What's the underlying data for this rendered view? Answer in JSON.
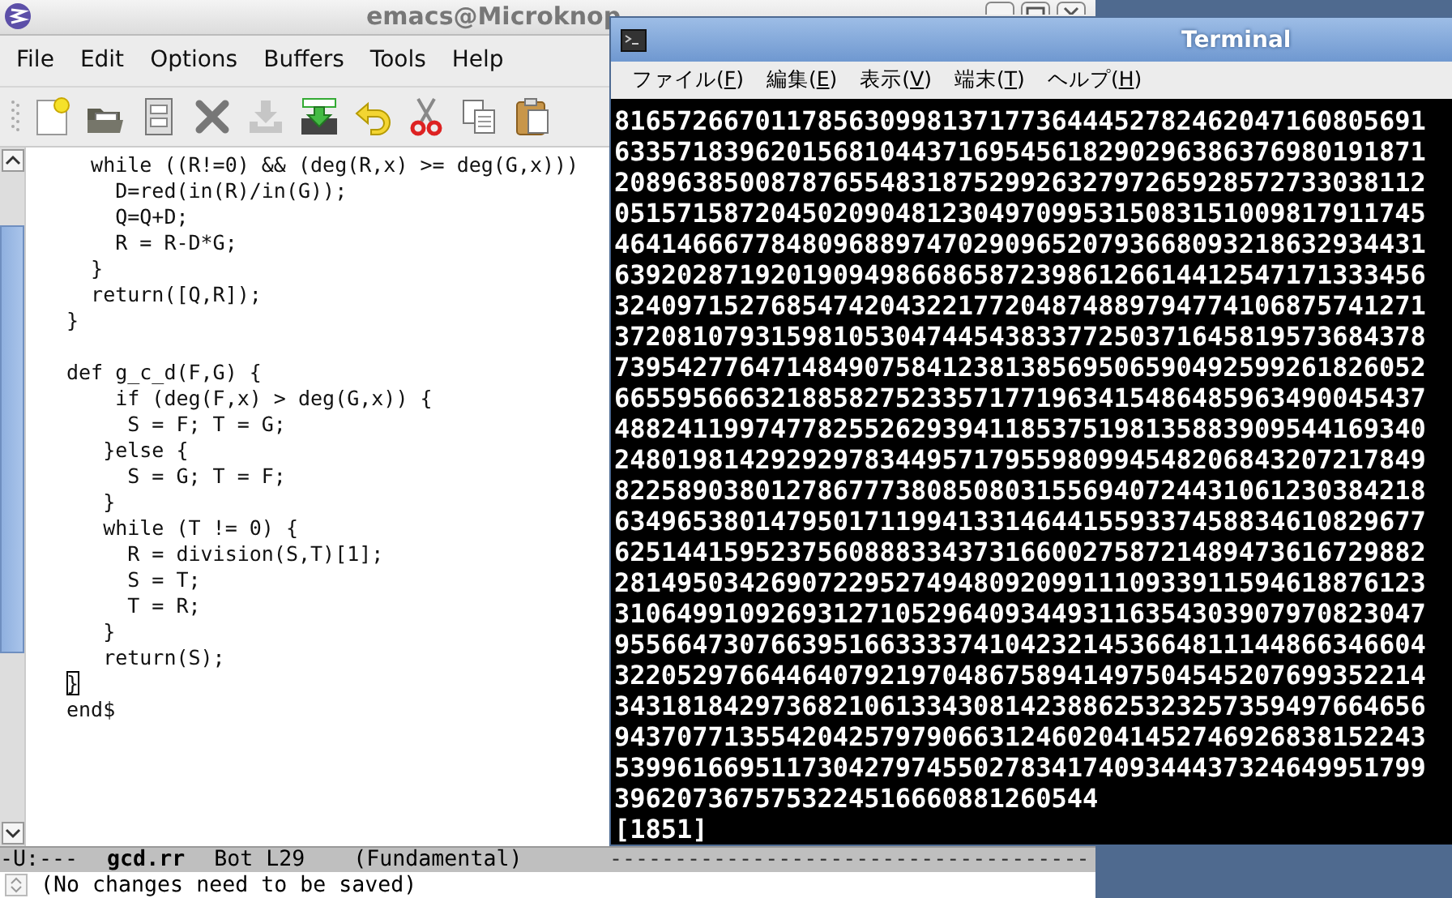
{
  "emacs_window": {
    "title": "emacs@Microknop",
    "menu": [
      "File",
      "Edit",
      "Options",
      "Buffers",
      "Tools",
      "Help"
    ],
    "toolbar": [
      {
        "kind": "new",
        "disabled": false
      },
      {
        "kind": "open",
        "disabled": false
      },
      {
        "kind": "save",
        "disabled": false
      },
      {
        "kind": "close",
        "disabled": false
      },
      {
        "kind": "download",
        "disabled": true
      },
      {
        "kind": "save-as",
        "disabled": false
      },
      {
        "kind": "undo",
        "disabled": false
      },
      {
        "kind": "cut",
        "disabled": false
      },
      {
        "kind": "copy",
        "disabled": false
      },
      {
        "kind": "paste",
        "disabled": false
      }
    ],
    "code_blocks": [
      [
        {
          "text": "  while ((R!=0) && (deg(R,x) >= deg(G,x)))",
          "cursor": false
        },
        {
          "text": "    D=red(in(R)/in(G));",
          "cursor": false
        },
        {
          "text": "    Q=Q+D;",
          "cursor": false
        },
        {
          "text": "    R = R-D*G;",
          "cursor": false
        },
        {
          "text": "  }",
          "cursor": false
        },
        {
          "text": "  return([Q,R]);",
          "cursor": false
        },
        {
          "text": "}",
          "cursor": false
        }
      ],
      [
        {
          "text": "def g_c_d(F,G) {",
          "cursor": false
        },
        {
          "text": "    if (deg(F,x) > deg(G,x)) {",
          "cursor": false
        },
        {
          "text": "     S = F; T = G;",
          "cursor": false
        },
        {
          "text": "   }else {",
          "cursor": false
        },
        {
          "text": "     S = G; T = F;",
          "cursor": false
        },
        {
          "text": "   }",
          "cursor": false
        },
        {
          "text": "   while (T != 0) {",
          "cursor": false
        },
        {
          "text": "     R = division(S,T)[1];",
          "cursor": false
        },
        {
          "text": "     S = T;",
          "cursor": false
        },
        {
          "text": "     T = R;",
          "cursor": false
        },
        {
          "text": "   }",
          "cursor": false
        },
        {
          "text": "   return(S);",
          "cursor": false
        },
        {
          "text": "}",
          "cursor": true
        },
        {
          "text": "end$",
          "cursor": false
        }
      ]
    ],
    "mode_line": {
      "status": "-U:---",
      "buffer": "gcd.rr",
      "position": "Bot L29",
      "mode": "(Fundamental)",
      "fill": "-------------------------------------"
    },
    "minibuffer": "(No changes need to be saved)"
  },
  "terminal_window": {
    "title": "Terminal",
    "menu": [
      {
        "before": "ファイル(",
        "key": "F",
        "after": ")"
      },
      {
        "before": "編集(",
        "key": "E",
        "after": ")"
      },
      {
        "before": "表示(",
        "key": "V",
        "after": ")"
      },
      {
        "before": "端末(",
        "key": "T",
        "after": ")"
      },
      {
        "before": "ヘルプ(",
        "key": "H",
        "after": ")"
      }
    ],
    "output_lines": [
      "8165726670117856309981371773644452782462047160805691",
      "6335718396201568104437169545618290296386376980191871",
      "2089638500878765548318752992632797265928572733038112",
      "0515715872045020904812304970995315083151009817911745",
      "4641466677848096889747029096520793668093218632934431",
      "6392028719201909498668658723986126614412547171333456",
      "3240971527685474204322177204874889794774106875741271",
      "3720810793159810530474454383377250371645819573684378",
      "7395427764714849075841238138569506590492599261826052",
      "6655956663218858275233571771963415486485963490045437",
      "4882411997477825526293941185375198135883909544169340",
      "2480198142929297834495717955980994548206843207217849",
      "8225890380127867773808508031556940724431061230384218",
      "6349653801479501711994133146441559337458834610829677",
      "6251441595237560888334373166002758721489473616729882",
      "2814950342690722952749480920991110933911594618876123",
      "3106499109269312710529640934493116354303907970823047",
      "9556647307663951663333741042321453664811144866346604",
      "3220529766446407921970486758941497504545207699352214",
      "3431818429736821061334308142388625323257359497664656",
      "9437077135542042579790663124602041452746926838152243",
      "5399616695117304279745502783417409344437324649951799",
      "3962073675753224516660881260544",
      "[1851]"
    ]
  }
}
